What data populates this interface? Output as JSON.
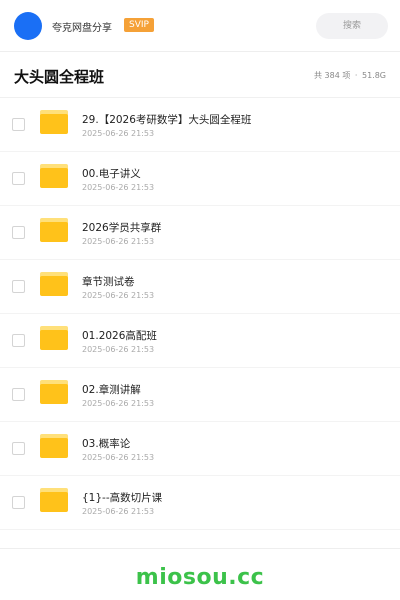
{
  "header": {
    "share_name": "夸克网盘分享",
    "badge": "SVIP",
    "search_placeholder": "搜索",
    "avatar_color": "#1a6ff5",
    "badge_color": "#f5a137"
  },
  "folder": {
    "title": "大头圆全程班",
    "item_count": "共 384 项",
    "separator": "·",
    "total_size": "51.8G"
  },
  "items": [
    {
      "name": "29.【2026考研数学】大头圆全程班",
      "date": "2025-06-26 21:53",
      "icon": "folder-icon"
    },
    {
      "name": "00.电子讲义",
      "date": "2025-06-26 21:53",
      "icon": "folder-icon"
    },
    {
      "name": "2026学员共享群",
      "date": "2025-06-26 21:53",
      "icon": "folder-icon"
    },
    {
      "name": "章节测试卷",
      "date": "2025-06-26 21:53",
      "icon": "folder-icon"
    },
    {
      "name": "01.2026高配班",
      "date": "2025-06-26 21:53",
      "icon": "folder-icon"
    },
    {
      "name": "02.章测讲解",
      "date": "2025-06-26 21:53",
      "icon": "folder-icon"
    },
    {
      "name": "03.概率论",
      "date": "2025-06-26 21:53",
      "icon": "folder-icon"
    },
    {
      "name": "{1}--高数切片课",
      "date": "2025-06-26 21:53",
      "icon": "folder-icon"
    }
  ],
  "watermark": "miosou.cc",
  "colors": {
    "folder": "#ffc21a",
    "watermark": "#3cc24a"
  }
}
